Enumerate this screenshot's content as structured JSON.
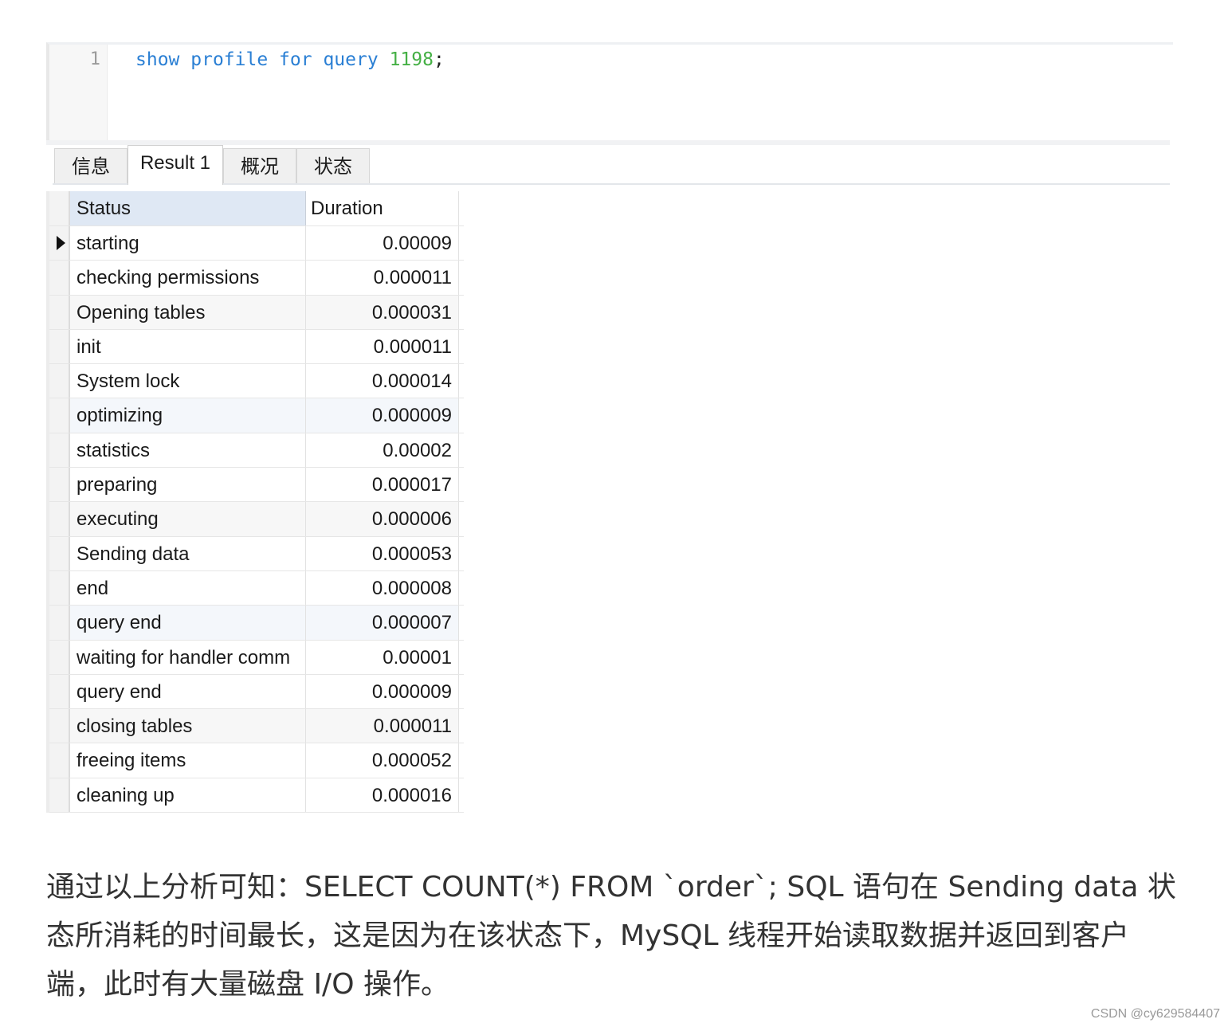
{
  "editor": {
    "line_number": "1",
    "code": {
      "show": "show",
      "profile": "profile",
      "for": "for",
      "query": "query",
      "id": "1198",
      "semicolon": ";"
    }
  },
  "tabs": [
    {
      "label": "信息",
      "active": false
    },
    {
      "label": "Result 1",
      "active": true
    },
    {
      "label": "概况",
      "active": false
    },
    {
      "label": "状态",
      "active": false
    }
  ],
  "grid": {
    "columns": [
      "Status",
      "Duration"
    ],
    "rows": [
      {
        "status": "starting",
        "duration": "0.00009"
      },
      {
        "status": "checking permissions",
        "duration": "0.000011"
      },
      {
        "status": "Opening tables",
        "duration": "0.000031"
      },
      {
        "status": "init",
        "duration": "0.000011"
      },
      {
        "status": "System lock",
        "duration": "0.000014"
      },
      {
        "status": "optimizing",
        "duration": "0.000009"
      },
      {
        "status": "statistics",
        "duration": "0.00002"
      },
      {
        "status": "preparing",
        "duration": "0.000017"
      },
      {
        "status": "executing",
        "duration": "0.000006"
      },
      {
        "status": "Sending data",
        "duration": "0.000053"
      },
      {
        "status": "end",
        "duration": "0.000008"
      },
      {
        "status": "query end",
        "duration": "0.000007"
      },
      {
        "status": "waiting for handler comm",
        "duration": "0.00001"
      },
      {
        "status": "query end",
        "duration": "0.000009"
      },
      {
        "status": "closing tables",
        "duration": "0.000011"
      },
      {
        "status": "freeing items",
        "duration": "0.000052"
      },
      {
        "status": "cleaning up",
        "duration": "0.000016"
      }
    ]
  },
  "article": {
    "paragraph": "通过以上分析可知：SELECT COUNT(*) FROM `order`; SQL 语句在 Sending data 状态所消耗的时间最长，这是因为在该状态下，MySQL 线程开始读取数据并返回到客户端，此时有大量磁盘 I/O 操作。"
  },
  "watermark": "CSDN @cy629584407",
  "colors": {
    "keyword": "#2a7fd4",
    "number": "#45b045",
    "header_highlight": "#dfe8f4"
  }
}
